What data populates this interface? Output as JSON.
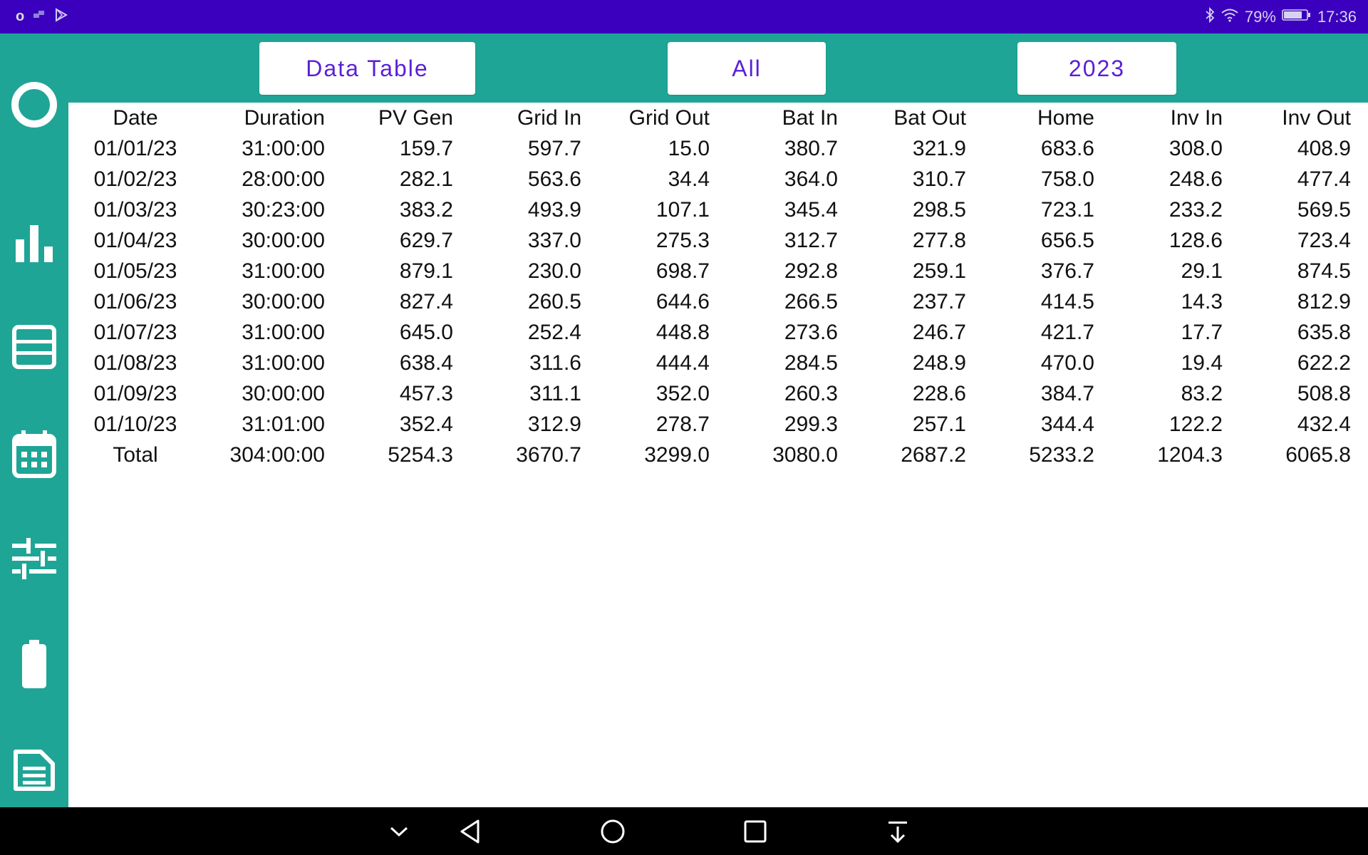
{
  "status_bar": {
    "left_text": "o",
    "battery_percent": "79%",
    "time": "17:36"
  },
  "toolbar": {
    "view_label": "Data Table",
    "filter_label": "All",
    "year_label": "2023"
  },
  "sidebar": {
    "items": [
      {
        "name": "overview",
        "icon": "circle-icon"
      },
      {
        "name": "charts",
        "icon": "bar-chart-icon"
      },
      {
        "name": "data-table",
        "icon": "table-icon"
      },
      {
        "name": "calendar",
        "icon": "calendar-icon"
      },
      {
        "name": "settings",
        "icon": "sliders-icon"
      },
      {
        "name": "battery",
        "icon": "battery-icon"
      },
      {
        "name": "log",
        "icon": "document-icon"
      }
    ]
  },
  "table": {
    "headers": [
      "Date",
      "Duration",
      "PV Gen",
      "Grid In",
      "Grid Out",
      "Bat In",
      "Bat Out",
      "Home",
      "Inv In",
      "Inv Out"
    ],
    "rows": [
      [
        "01/01/23",
        "31:00:00",
        "159.7",
        "597.7",
        "15.0",
        "380.7",
        "321.9",
        "683.6",
        "308.0",
        "408.9"
      ],
      [
        "01/02/23",
        "28:00:00",
        "282.1",
        "563.6",
        "34.4",
        "364.0",
        "310.7",
        "758.0",
        "248.6",
        "477.4"
      ],
      [
        "01/03/23",
        "30:23:00",
        "383.2",
        "493.9",
        "107.1",
        "345.4",
        "298.5",
        "723.1",
        "233.2",
        "569.5"
      ],
      [
        "01/04/23",
        "30:00:00",
        "629.7",
        "337.0",
        "275.3",
        "312.7",
        "277.8",
        "656.5",
        "128.6",
        "723.4"
      ],
      [
        "01/05/23",
        "31:00:00",
        "879.1",
        "230.0",
        "698.7",
        "292.8",
        "259.1",
        "376.7",
        "29.1",
        "874.5"
      ],
      [
        "01/06/23",
        "30:00:00",
        "827.4",
        "260.5",
        "644.6",
        "266.5",
        "237.7",
        "414.5",
        "14.3",
        "812.9"
      ],
      [
        "01/07/23",
        "31:00:00",
        "645.0",
        "252.4",
        "448.8",
        "273.6",
        "246.7",
        "421.7",
        "17.7",
        "635.8"
      ],
      [
        "01/08/23",
        "31:00:00",
        "638.4",
        "311.6",
        "444.4",
        "284.5",
        "248.9",
        "470.0",
        "19.4",
        "622.2"
      ],
      [
        "01/09/23",
        "30:00:00",
        "457.3",
        "311.1",
        "352.0",
        "260.3",
        "228.6",
        "384.7",
        "83.2",
        "508.8"
      ],
      [
        "01/10/23",
        "31:01:00",
        "352.4",
        "312.9",
        "278.7",
        "299.3",
        "257.1",
        "344.4",
        "122.2",
        "432.4"
      ]
    ],
    "total": [
      "Total",
      "304:00:00",
      "5254.3",
      "3670.7",
      "3299.0",
      "3080.0",
      "2687.2",
      "5233.2",
      "1204.3",
      "6065.8"
    ]
  },
  "nav_bar": {
    "buttons": [
      "chevron-down-icon",
      "back-icon",
      "home-icon",
      "recents-icon",
      "notification-shade-icon"
    ]
  },
  "colors": {
    "status_bar": "#3a00bd",
    "accent_teal": "#1fa596",
    "button_text": "#5a1fd6"
  }
}
